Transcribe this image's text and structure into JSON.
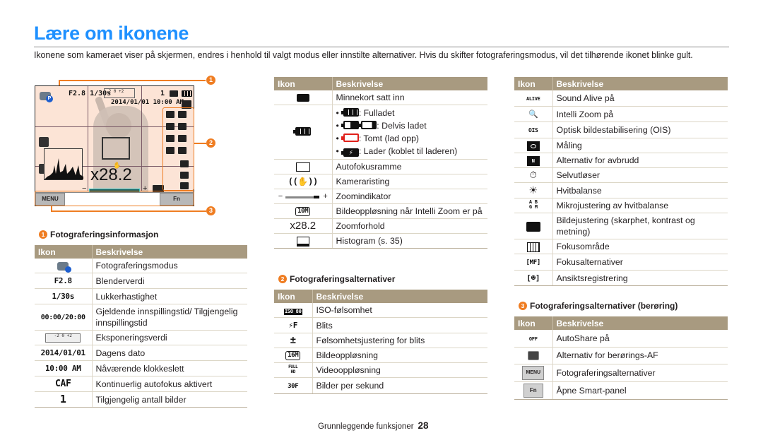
{
  "page": {
    "title": "Lære om ikonene",
    "intro": "Ikonene som kameraet viser på skjermen, endres i henhold til valgt modus eller innstilte alternativer. Hvis du skifter fotograferingsmodus, vil det tilhørende ikonet blinke gult.",
    "footer_section": "Grunnleggende funksjoner",
    "footer_page": "28"
  },
  "colors": {
    "title_blue": "#1e90ff",
    "callout_orange": "#ef7d22",
    "table_header": "#a89a80",
    "lcd_background": "#fce4d6"
  },
  "lcd": {
    "aperture_shutter": "F2.8 1/30s",
    "ev_scale": "-2   0   +2",
    "shots": "1",
    "date_time": "2014/01/01  10:00 AM",
    "zoom_ratio": "x28.2",
    "menu_button": "MENU",
    "fn_button": "Fn",
    "callouts": [
      "1",
      "2",
      "3"
    ]
  },
  "table_headers": {
    "icon": "Ikon",
    "description": "Beskrivelse"
  },
  "sections": [
    {
      "number": "1",
      "title": "Fotograferingsinformasjon",
      "rows": [
        {
          "icon": "shooting-mode-icon",
          "icon_text": "",
          "description": "Fotograferingsmodus"
        },
        {
          "icon": "aperture-value",
          "icon_text": "F2.8",
          "description": "Blenderverdi"
        },
        {
          "icon": "shutter-speed",
          "icon_text": "1/30s",
          "description": "Lukkerhastighet"
        },
        {
          "icon": "recording-time",
          "icon_text": "00:00/20:00",
          "description": "Gjeldende innspillingstid/ Tilgjengelig innspillingstid"
        },
        {
          "icon": "exposure-meter-icon",
          "icon_text": "-2 0 +2",
          "description": "Eksponeringsverdi"
        },
        {
          "icon": "date",
          "icon_text": "2014/01/01",
          "description": "Dagens dato"
        },
        {
          "icon": "time",
          "icon_text": "10:00 AM",
          "description": "Nåværende klokkeslett"
        },
        {
          "icon": "caf",
          "icon_text": "CAF",
          "description": "Kontinuerlig autofokus aktivert"
        },
        {
          "icon": "shots-remaining",
          "icon_text": "1",
          "description": "Tilgjengelig antall bilder"
        }
      ]
    },
    {
      "number": "1b",
      "title": "",
      "rows": [
        {
          "icon": "memory-card-icon",
          "icon_text": "",
          "description": "Minnekort satt inn"
        },
        {
          "icon": "battery-icon",
          "icon_text": "",
          "description": "",
          "bullets": [
            ": Fulladet",
            ": Delvis ladet",
            ": Tomt (lad opp)",
            ": Lader (koblet til laderen)"
          ]
        },
        {
          "icon": "af-frame-icon",
          "icon_text": "",
          "description": "Autofokusramme"
        },
        {
          "icon": "camera-shake-icon",
          "icon_text": "",
          "description": "Kameraristing"
        },
        {
          "icon": "zoom-indicator-icon",
          "icon_text": "",
          "description": "Zoomindikator"
        },
        {
          "icon": "intelli-zoom-resolution-icon",
          "icon_text": "10M",
          "description": "Bildeoppløsning når Intelli Zoom er på"
        },
        {
          "icon": "zoom-ratio",
          "icon_text": "x28.2",
          "description": "Zoomforhold"
        },
        {
          "icon": "histogram-icon",
          "icon_text": "",
          "description": "Histogram (s. 35)"
        }
      ]
    },
    {
      "number": "2",
      "title": "Fotograferingsalternativer",
      "rows": [
        {
          "icon": "iso-icon",
          "icon_text": "ISO 80",
          "description": "ISO-følsomhet"
        },
        {
          "icon": "flash-icon",
          "icon_text": "⚡F",
          "description": "Blits"
        },
        {
          "icon": "flash-compensation-icon",
          "icon_text": "±",
          "description": "Følsomhetsjustering for blits"
        },
        {
          "icon": "photo-resolution-icon",
          "icon_text": "16M",
          "description": "Bildeoppløsning"
        },
        {
          "icon": "video-resolution-icon",
          "icon_text": "FULL HD",
          "description": "Videooppløsning"
        },
        {
          "icon": "fps-icon",
          "icon_text": "30F",
          "description": "Bilder per sekund"
        }
      ]
    },
    {
      "number": "2b",
      "title": "",
      "rows": [
        {
          "icon": "sound-alive-icon",
          "icon_text": "ALIVE",
          "description": "Sound Alive på"
        },
        {
          "icon": "intelli-zoom-icon",
          "icon_text": "🔍",
          "description": "Intelli Zoom på"
        },
        {
          "icon": "ois-icon",
          "icon_text": "OIS",
          "description": "Optisk bildestabilisering (OIS)"
        },
        {
          "icon": "metering-icon",
          "icon_text": "",
          "description": "Måling"
        },
        {
          "icon": "drive-mode-icon",
          "icon_text": "N",
          "description": "Alternativ for avbrudd"
        },
        {
          "icon": "self-timer-icon",
          "icon_text": "⏱",
          "description": "Selvutløser"
        },
        {
          "icon": "white-balance-icon",
          "icon_text": "☀",
          "description": "Hvitbalanse"
        },
        {
          "icon": "wb-fine-tune-icon",
          "icon_text": "A B G M",
          "description": "Mikrojustering av hvitbalanse"
        },
        {
          "icon": "image-adjust-icon",
          "icon_text": "",
          "description": "Bildejustering (skarphet, kontrast og metning)"
        },
        {
          "icon": "focus-area-icon",
          "icon_text": "",
          "description": "Fokusområde"
        },
        {
          "icon": "focus-options-icon",
          "icon_text": "MF",
          "description": "Fokusalternativer"
        },
        {
          "icon": "face-detection-icon",
          "icon_text": "",
          "description": "Ansiktsregistrering"
        }
      ]
    },
    {
      "number": "3",
      "title": "Fotograferingsalternativer (berøring)",
      "rows": [
        {
          "icon": "autoshare-icon",
          "icon_text": "OFF",
          "description": "AutoShare på"
        },
        {
          "icon": "touch-af-icon",
          "icon_text": "",
          "description": "Alternativ for berørings-AF"
        },
        {
          "icon": "menu-button-icon",
          "icon_text": "MENU",
          "description": "Fotograferingsalternativer"
        },
        {
          "icon": "fn-button-icon",
          "icon_text": "Fn",
          "description": "Åpne Smart-panel"
        }
      ]
    }
  ]
}
